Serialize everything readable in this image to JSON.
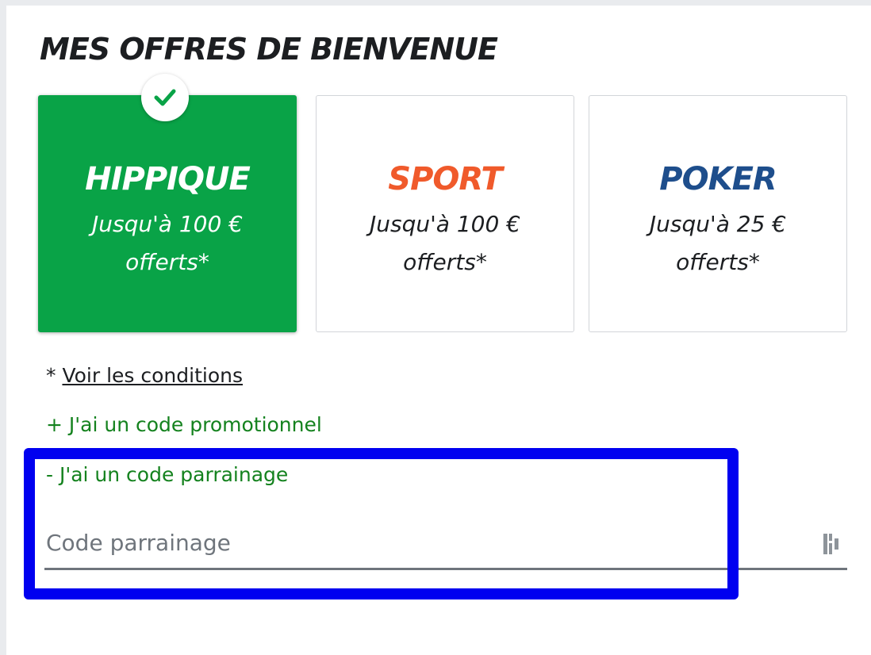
{
  "page": {
    "title": "MES OFFRES DE BIENVENUE"
  },
  "offers": [
    {
      "name": "HIPPIQUE",
      "desc": "Jusqu'à 100 € offerts*",
      "color": "#ffffff",
      "bg": "#09a347",
      "selected": true
    },
    {
      "name": "SPORT",
      "desc": "Jusqu'à 100 € offerts*",
      "color": "#f05a2b",
      "selected": false
    },
    {
      "name": "POKER",
      "desc": "Jusqu'à 25 € offerts*",
      "color": "#1e4e8c",
      "selected": false
    }
  ],
  "conditions": {
    "prefix": "* ",
    "link_label": "Voir les conditions"
  },
  "promo": {
    "toggle_label": "+ J'ai un code promotionnel"
  },
  "referral": {
    "toggle_label": "- J'ai un code parrainage",
    "placeholder": "Code parrainage",
    "value": "",
    "icon": "password-manager-icon"
  },
  "colors": {
    "accent_green": "#09a347",
    "link_green": "#14821e",
    "highlight_blue": "#0000f0"
  }
}
